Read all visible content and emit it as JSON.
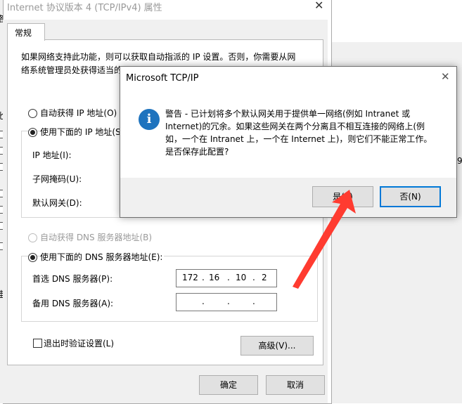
{
  "background_fragments": {
    "left_cut_chars": [
      "络",
      "比",
      "挂"
    ],
    "right_cut_chars": [
      "(",
      "9"
    ]
  },
  "properties_dialog": {
    "title": "Internet 协议版本 4 (TCP/IPv4) 属性",
    "close_glyph": "✕",
    "tab_label": "常规",
    "description_line1": "如果网络支持此功能，则可以获取自动指派的 IP 设置。否则，你需要从网",
    "description_line2": "络系统管理员处获得适当的 IP 设置。",
    "auto_ip_label": "自动获得 IP 地址(O)",
    "manual_ip_label": "使用下面的 IP 地址(S",
    "ip_address_label": "IP 地址(I):",
    "subnet_mask_label": "子网掩码(U):",
    "default_gateway_label": "默认网关(D):",
    "auto_dns_label": "自动获得 DNS 服务器地址(B)",
    "manual_dns_label": "使用下面的 DNS 服务器地址(E):",
    "preferred_dns_label": "首选 DNS 服务器(P):",
    "preferred_dns_octets": [
      "172",
      "16",
      "10",
      "2"
    ],
    "alternate_dns_label": "备用 DNS 服务器(A):",
    "ip_dot": ".",
    "validate_on_exit_label": "退出时验证设置(L)",
    "advanced_button": "高级(V)...",
    "ok_button": "确定",
    "cancel_button": "取消"
  },
  "modal": {
    "title": "Microsoft TCP/IP",
    "close_glyph": "✕",
    "icon_glyph": "i",
    "message_lines": [
      "警告 - 已计划将多个默认网关用于提供单一网络(例如 Intranet 或",
      "Internet)的冗余。如果这些网关在两个分离且不相互连接的网络上(例",
      "如，一个在 Intranet 上，一个在 Internet 上)，则它们不能正常工作。",
      "是否保存此配置?"
    ],
    "yes_button": "是(Y)",
    "no_button": "否(N)"
  },
  "colors": {
    "info_icon": "#1e73be",
    "arrow": "#ff3b30",
    "focus_border": "#0078d7"
  }
}
